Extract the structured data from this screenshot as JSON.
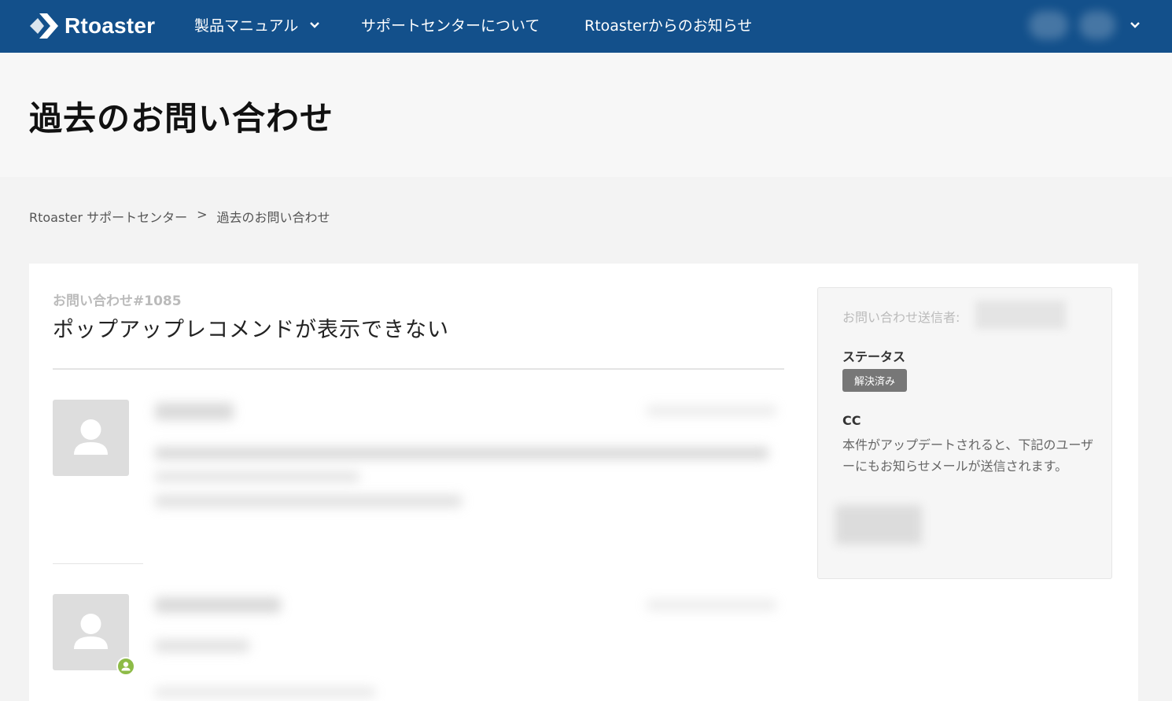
{
  "nav": {
    "logo_text": "Rtoaster",
    "items": [
      {
        "label": "製品マニュアル"
      },
      {
        "label": "サポートセンターについて"
      },
      {
        "label": "Rtoasterからのお知らせ"
      }
    ]
  },
  "page_title": "過去のお問い合わせ",
  "breadcrumb": {
    "home": "Rtoaster サポートセンター",
    "separator": ">",
    "current": "過去のお問い合わせ"
  },
  "request": {
    "id_label": "お問い合わせ#1085",
    "title": "ポップアップレコメンドが表示できない"
  },
  "sidebar": {
    "sender_label": "お問い合わせ送信者:",
    "status_heading": "ステータス",
    "status_value": "解決済み",
    "cc_heading": "CC",
    "cc_description": "本件がアップデートされると、下記のユーザーにもお知らせメールが送信されます。"
  },
  "colors": {
    "nav_bg": "#13508b",
    "status_badge_bg": "#777777",
    "agent_badge": "#8dbb47"
  }
}
